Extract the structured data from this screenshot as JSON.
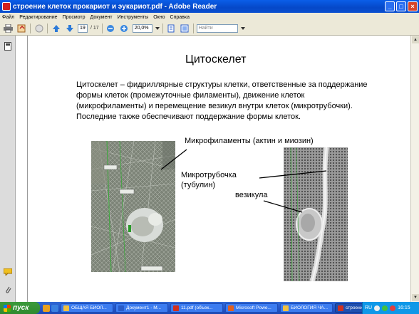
{
  "window": {
    "title": "строение клеток прокариот и эукариот.pdf - Adobe Reader",
    "minimize": "_",
    "maximize": "□",
    "close": "×"
  },
  "menu": [
    "Файл",
    "Редактирование",
    "Просмотр",
    "Документ",
    "Инструменты",
    "Окно",
    "Справка"
  ],
  "toolbar": {
    "page_current": "19",
    "page_total": "/ 17",
    "zoom": "20,0%",
    "search_placeholder": "Найти"
  },
  "slide": {
    "title": "Цитоскелет",
    "body": "Цитоскелет – фидриллярные структуры клетки, ответственные за поддержание формы клеток (промежуточные филаменты), движение клеток (микрофиламенты) и перемещение везикул внутри клеток (микротрубочки). Последние также обеспечивают поддержание формы клеток.",
    "label_microfilaments": "Микрофиламенты (актин и миозин)",
    "label_microtubule_1": "Микротрубочка",
    "label_microtubule_2": "(тубулин)",
    "label_vesicle": "везикула"
  },
  "taskbar": {
    "start": "пуск",
    "tasks": [
      {
        "label": "ОБЩАЯ БИОЛ...",
        "color": "#f0c040"
      },
      {
        "label": "Документ1 - M...",
        "color": "#2a5cc8"
      },
      {
        "label": "11.pdf (объек...",
        "color": "#d03020"
      },
      {
        "label": "Microsoft Powe...",
        "color": "#e06020"
      },
      {
        "label": "БИОЛОГИЯ ЧА...",
        "color": "#f0c040"
      },
      {
        "label": "строение клет...",
        "color": "#d03020"
      }
    ],
    "lang": "RU",
    "clock": "16:15"
  },
  "colors": {
    "titlebar": "#0548c8",
    "taskbar": "#2456c8",
    "start": "#2f8a2f"
  }
}
